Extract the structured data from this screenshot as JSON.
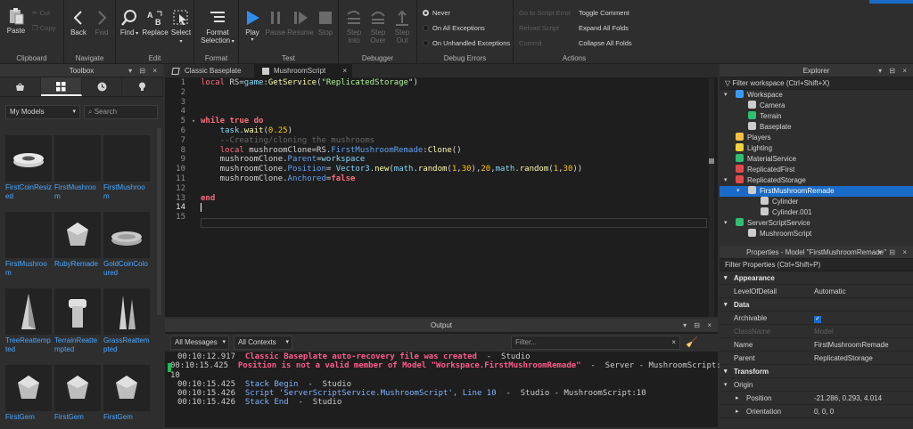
{
  "ribbon": {
    "clipboard": {
      "paste": "Paste",
      "cut": "Cut",
      "copy": "Copy",
      "label": "Clipboard"
    },
    "navigate": {
      "back": "Back",
      "fwd": "Fwd",
      "label": "Navigate"
    },
    "edit": {
      "find": "Find",
      "replace": "Replace",
      "select": "Select",
      "label": "Edit"
    },
    "format": {
      "format_selection": "Format Selection",
      "label": "Format"
    },
    "test": {
      "play": "Play",
      "pause": "Pause",
      "resume": "Resume",
      "stop": "Stop",
      "label": "Test"
    },
    "debugger": {
      "step_into": "Step Into",
      "step_over": "Step Over",
      "step_out": "Step Out",
      "label": "Debugger"
    },
    "debug_errors": {
      "never": "Never",
      "all": "On All Exceptions",
      "unhandled": "On Unhandled Exceptions",
      "label": "Debug Errors"
    },
    "actions": {
      "go_to_error": "Go to Script Error",
      "reload": "Reload Script",
      "commit": "Commit",
      "toggle_comment": "Toggle Comment",
      "expand_all": "Expand All Folds",
      "collapse_all": "Collapse All Folds",
      "label": "Actions"
    }
  },
  "toolbox": {
    "title": "Toolbox",
    "controls": "▾ ⊟ ×",
    "category": "My Models",
    "search_placeholder": "Search",
    "items": [
      "FirstCoinResized",
      "FirstMushroom",
      "FirstMushroom",
      "FirstMushroom",
      "RubyRemade",
      "GoldCoinColoured",
      "TreeReattempted",
      "TerrainReattempted",
      "GrassReattempted",
      "FirstGem",
      "FirstGem",
      "FirstGem"
    ]
  },
  "editor": {
    "tabs": [
      "Classic Baseplate",
      "MushroomScript"
    ],
    "line_numbers": [
      "1",
      "2",
      "3",
      "4",
      "5",
      "6",
      "7",
      "8",
      "9",
      "10",
      "11",
      "12",
      "13",
      "14",
      "15"
    ]
  },
  "output": {
    "title": "Output",
    "filter_messages": "All Messages",
    "filter_contexts": "All Contexts",
    "filter_placeholder": "Filter...",
    "lines": [
      {
        "time": "00:10:12.917",
        "msg": "Classic Baseplate auto-recovery file was created",
        "src": "  -  Studio",
        "kind": "red"
      },
      {
        "time": "00:10:15.425",
        "msg": "Position is not a valid member of Model \"Workspace.FirstMushroomRemade\"",
        "src": "  -  Server - MushroomScript:",
        "kind": "red",
        "wrap": "10"
      },
      {
        "time": "00:10:15.425",
        "msg": "Stack Begin",
        "src": "  -  Studio",
        "kind": "blue"
      },
      {
        "time": "00:10:15.426",
        "msg": "Script 'ServerScriptService.MushroomScript', Line 10",
        "src": "  -  Studio - MushroomScript:10",
        "kind": "blue"
      },
      {
        "time": "00:10:15.426",
        "msg": "Stack End",
        "src": "  -  Studio",
        "kind": "blue"
      }
    ]
  },
  "explorer": {
    "title": "Explorer",
    "filter": "Filter workspace (Ctrl+Shift+X)",
    "items": [
      "Workspace",
      "Camera",
      "Terrain",
      "Baseplate",
      "Players",
      "Lighting",
      "MaterialService",
      "ReplicatedFirst",
      "ReplicatedStorage",
      "FirstMushroomRemade",
      "Cylinder",
      "Cylinder.001",
      "ServerScriptService",
      "MushroomScript"
    ]
  },
  "properties": {
    "title": "Properties - Model \"FirstMushroomRemade\"",
    "filter": "Filter Properties (Ctrl+Shift+P)",
    "appearance": "Appearance",
    "level_of_detail": {
      "k": "LevelOfDetail",
      "v": "Automatic"
    },
    "data": "Data",
    "archivable": "Archivable",
    "classname": {
      "k": "ClassName",
      "v": "Model"
    },
    "name": {
      "k": "Name",
      "v": "FirstMushroomRemade"
    },
    "parent": {
      "k": "Parent",
      "v": "ReplicatedStorage"
    },
    "transform": "Transform",
    "origin": "Origin",
    "position": {
      "k": "Position",
      "v": "-21.286, 0.293, 4.014"
    },
    "orientation": {
      "k": "Orientation",
      "v": "0, 0, 0"
    }
  }
}
